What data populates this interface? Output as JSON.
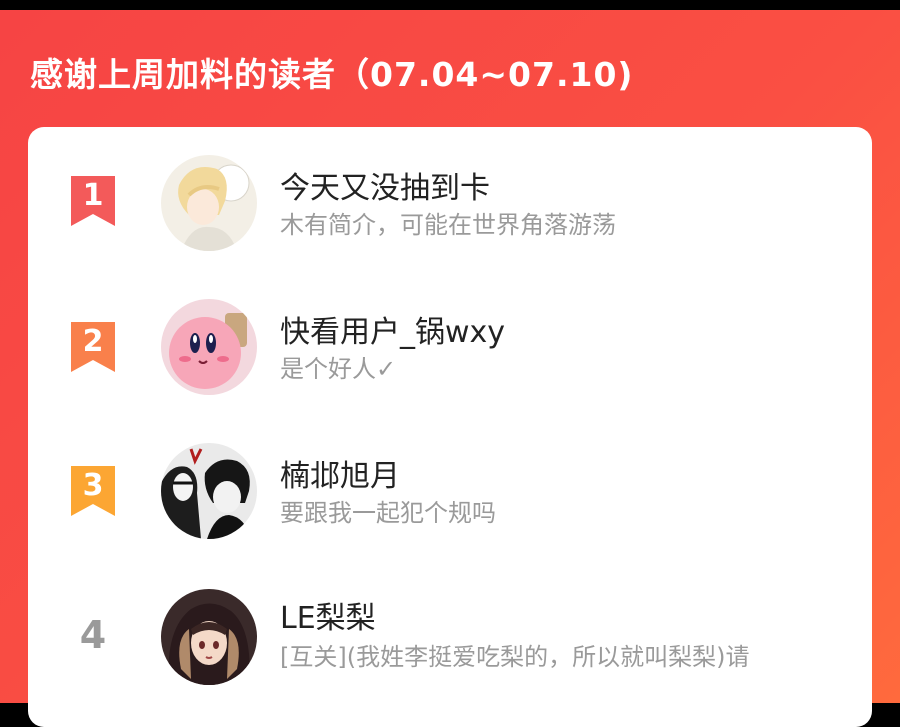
{
  "header": {
    "title": "感谢上周加料的读者（07.04~07.10)"
  },
  "colors": {
    "rank1": "#f35a5a",
    "rank2": "#f9804b",
    "rank3": "#fca633",
    "plain_rank": "#9a9a9a"
  },
  "readers": [
    {
      "rank": "1",
      "name": "今天又没抽到卡",
      "bio": "木有简介，可能在世界角落游荡",
      "avatar_icon": "anime-boy-avatar"
    },
    {
      "rank": "2",
      "name": "快看用户_锅wxy",
      "bio": "是个好人✓",
      "avatar_icon": "kirby-avatar"
    },
    {
      "rank": "3",
      "name": "楠邶旭月",
      "bio": "要跟我一起犯个规吗",
      "avatar_icon": "manga-duo-avatar"
    },
    {
      "rank": "4",
      "name": "LE梨梨",
      "bio": "[互关](我姓李挺爱吃梨的，所以就叫梨梨)请",
      "avatar_icon": "anime-girl-avatar"
    }
  ]
}
